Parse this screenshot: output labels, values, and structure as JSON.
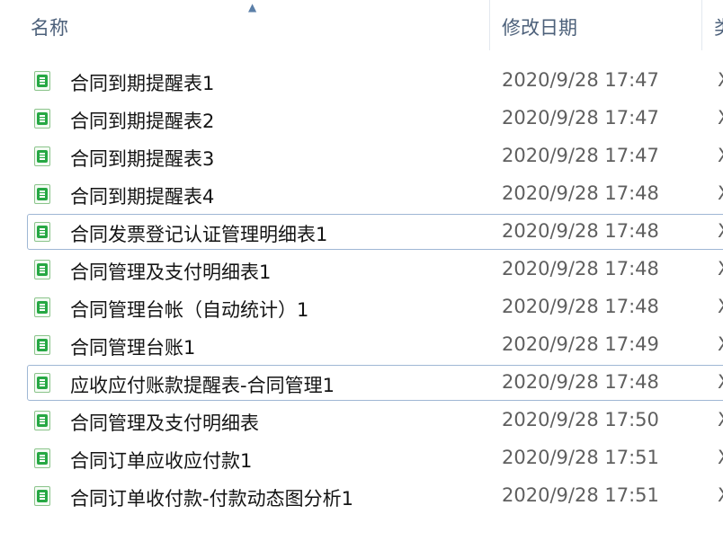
{
  "header": {
    "name_label": "名称",
    "date_label": "修改日期",
    "type_label": "类",
    "sort_indicator": "▲"
  },
  "files": [
    {
      "name": "合同到期提醒表1",
      "date": "2020/9/28 17:47",
      "type": "X",
      "selected": false
    },
    {
      "name": "合同到期提醒表2",
      "date": "2020/9/28 17:47",
      "type": "X",
      "selected": false
    },
    {
      "name": "合同到期提醒表3",
      "date": "2020/9/28 17:47",
      "type": "X",
      "selected": false
    },
    {
      "name": "合同到期提醒表4",
      "date": "2020/9/28 17:48",
      "type": "X",
      "selected": false
    },
    {
      "name": "合同发票登记认证管理明细表1",
      "date": "2020/9/28 17:48",
      "type": "X",
      "selected": true
    },
    {
      "name": "合同管理及支付明细表1",
      "date": "2020/9/28 17:48",
      "type": "X",
      "selected": false
    },
    {
      "name": "合同管理台帐（自动统计）1",
      "date": "2020/9/28 17:48",
      "type": "X",
      "selected": false
    },
    {
      "name": "合同管理台账1",
      "date": "2020/9/28 17:49",
      "type": "X",
      "selected": false
    },
    {
      "name": "应收应付账款提醒表-合同管理1",
      "date": "2020/9/28 17:48",
      "type": "X",
      "selected": true
    },
    {
      "name": "合同管理及支付明细表",
      "date": "2020/9/28 17:50",
      "type": "X",
      "selected": false
    },
    {
      "name": "合同订单应收应付款1",
      "date": "2020/9/28 17:51",
      "type": "X",
      "selected": false
    },
    {
      "name": "合同订单收付款-付款动态图分析1",
      "date": "2020/9/28 17:51",
      "type": "X",
      "selected": false
    }
  ],
  "icons": {
    "file_icon": "spreadsheet-file-icon",
    "accent": "#27a844"
  }
}
